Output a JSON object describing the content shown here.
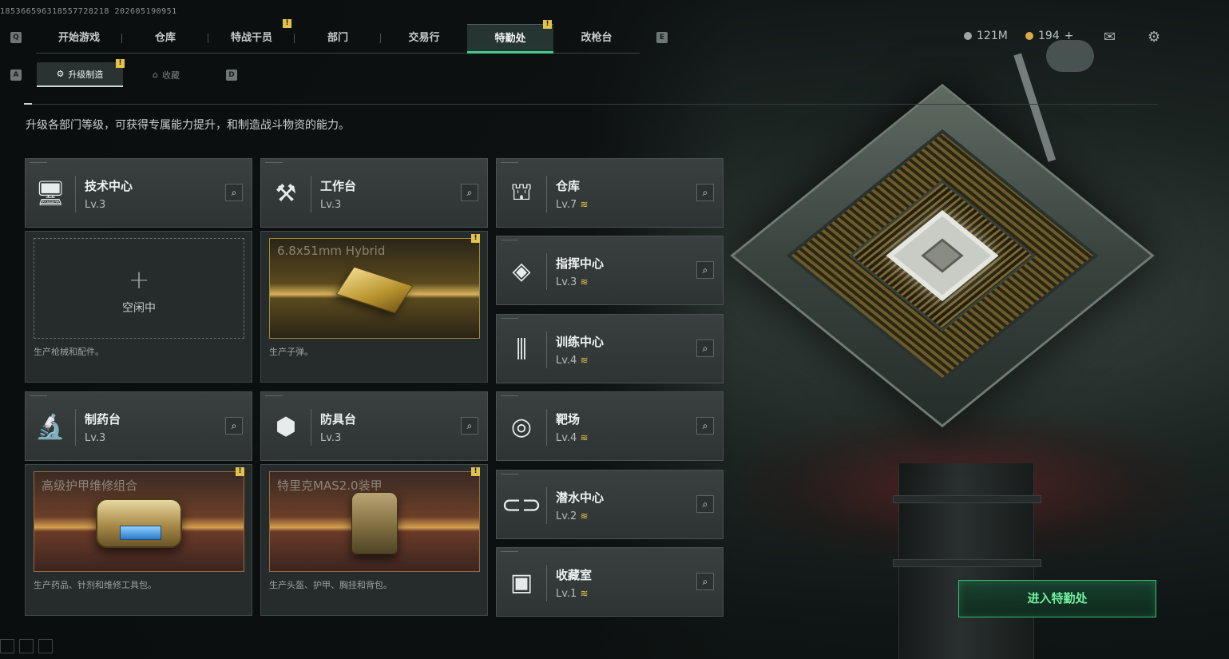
{
  "session_id": "18536659631855772821​8 202605190951",
  "nav": {
    "hint_left": "Q",
    "hint_right": "E",
    "tabs": [
      {
        "label": "开始游戏",
        "badge": ""
      },
      {
        "label": "仓库",
        "badge": ""
      },
      {
        "label": "特战干员",
        "badge": "!"
      },
      {
        "label": "部门",
        "badge": ""
      },
      {
        "label": "交易行",
        "badge": ""
      },
      {
        "label": "特勤处",
        "badge": "!"
      },
      {
        "label": "改枪台",
        "badge": ""
      }
    ],
    "active_tab": "特勤处"
  },
  "subnav": {
    "hint_left": "A",
    "hint_right": "D",
    "tabs": [
      {
        "label": "升级制造",
        "badge": "!"
      },
      {
        "label": "收藏",
        "badge": ""
      }
    ]
  },
  "currency": {
    "silver": "121M",
    "gold": "194",
    "gold_add": "+"
  },
  "intro": "升级各部门等级，可获得专属能力提升，和制造战斗物资的能力。",
  "production": [
    {
      "name": "技术中心",
      "level": "Lv.3",
      "status": "空闲中",
      "item": "",
      "desc": "生产枪械和配件。",
      "badge": ""
    },
    {
      "name": "工作台",
      "level": "Lv.3",
      "status": "",
      "item": "6.8x51mm Hybrid",
      "desc": "生产子弹。",
      "badge": "!"
    },
    {
      "name": "制药台",
      "level": "Lv.3",
      "status": "",
      "item": "高级护甲维修组合",
      "desc": "生产药品、针剂和维修工具包。",
      "badge": "!"
    },
    {
      "name": "防具台",
      "level": "Lv.3",
      "status": "",
      "item": "特里克MAS2.0装甲",
      "desc": "生产头盔、护甲、胸挂和背包。",
      "badge": "!"
    }
  ],
  "facilities": [
    {
      "name": "仓库",
      "level": "Lv.7",
      "upgrade": "≋"
    },
    {
      "name": "指挥中心",
      "level": "Lv.3",
      "upgrade": "≋"
    },
    {
      "name": "训练中心",
      "level": "Lv.4",
      "upgrade": "≋"
    },
    {
      "name": "靶场",
      "level": "Lv.4",
      "upgrade": "≋"
    },
    {
      "name": "潜水中心",
      "level": "Lv.2",
      "upgrade": "≋"
    },
    {
      "name": "收藏室",
      "level": "Lv.1",
      "upgrade": "≋"
    }
  ],
  "cta": "进入特勤处",
  "icons": {
    "mail": "envelope-icon",
    "settings": "gear-icon",
    "search": "magnifier-icon"
  },
  "colors": {
    "accent_green": "#44c98a",
    "badge_yellow": "#e3c24c",
    "upgrade_gold": "#e6c24a"
  }
}
